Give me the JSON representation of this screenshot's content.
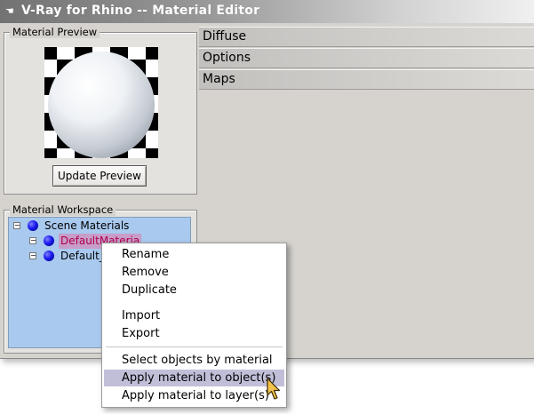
{
  "window": {
    "title": "V-Ray for Rhino -- Material Editor",
    "app_icon": "vray-hand-icon"
  },
  "preview": {
    "group_label": "Material Preview",
    "update_button": "Update Preview"
  },
  "workspace": {
    "group_label": "Material Workspace",
    "tree": {
      "root": {
        "label": "Scene Materials",
        "expander": "−"
      },
      "children": [
        {
          "label": "DefaultMateria",
          "expander": "−",
          "selected": true
        },
        {
          "label": "Default_",
          "expander": "−",
          "selected": false
        }
      ]
    }
  },
  "sections": [
    {
      "label": "Diffuse"
    },
    {
      "label": "Options"
    },
    {
      "label": "Maps"
    }
  ],
  "context_menu": {
    "items": [
      {
        "label": "Rename"
      },
      {
        "label": "Remove"
      },
      {
        "label": "Duplicate"
      },
      {
        "label": "Import"
      },
      {
        "label": "Export"
      },
      {
        "label": "Select objects by material"
      },
      {
        "label": "Apply material to object(s)",
        "highlighted": true
      },
      {
        "label": "Apply material to layer(s)"
      }
    ]
  },
  "colors": {
    "tree_background": "#a9c9ee",
    "menu_highlight": "#c1bfd8",
    "selection": "#c79dc9",
    "material_ball": "#1a1aee"
  }
}
